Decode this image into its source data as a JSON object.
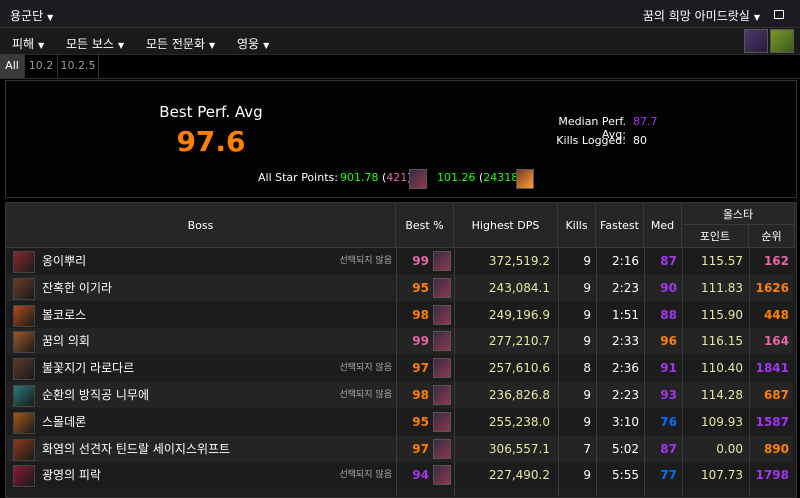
{
  "topbar": {
    "guild": "용군단",
    "raid": "꿈의 희망 아미드랏실"
  },
  "menus": [
    {
      "label": "피해"
    },
    {
      "label": "모든 보스"
    },
    {
      "label": "모든 전문화"
    },
    {
      "label": "영웅"
    }
  ],
  "tabs": [
    {
      "label": "All"
    },
    {
      "label": "10.2"
    },
    {
      "label": "10.2.5"
    }
  ],
  "summary": {
    "best_perf_label": "Best Perf. Avg",
    "best_perf_value": "97.6",
    "median_label": "Median Perf. Avg:",
    "median_value": "87.7",
    "kills_label": "Kills Logged:",
    "kills_value": "80",
    "star_label": "All Star Points:",
    "star1_points": "901.78",
    "star1_rank": "421",
    "star2_points": "101.26",
    "star2_rank": "24318"
  },
  "table": {
    "headers": {
      "boss": "Boss",
      "best": "Best %",
      "dps": "Highest DPS",
      "kills": "Kills",
      "fastest": "Fastest",
      "med": "Med",
      "allstar": "올스타",
      "points": "포인트",
      "rank": "순위"
    },
    "rows": [
      {
        "name": "옹이뿌리",
        "tag": "선택되지 않음",
        "best": "99",
        "dps": "372,519.2",
        "kills": "9",
        "fastest": "2:16",
        "med": "87",
        "points": "115.57",
        "rank": "162",
        "best_color": "#e268a8",
        "med_color": "#a335ee",
        "rank_color": "#e268a8",
        "icon_color": "#8a2a30"
      },
      {
        "name": "잔혹한 이기라",
        "tag": "",
        "best": "95",
        "dps": "243,084.1",
        "kills": "9",
        "fastest": "2:23",
        "med": "90",
        "points": "111.83",
        "rank": "1626",
        "best_color": "#ff8000",
        "med_color": "#a335ee",
        "rank_color": "#ff8000",
        "icon_color": "#6a3a2a"
      },
      {
        "name": "볼코로스",
        "tag": "",
        "best": "98",
        "dps": "249,196.9",
        "kills": "9",
        "fastest": "1:51",
        "med": "88",
        "points": "115.90",
        "rank": "448",
        "best_color": "#ff8000",
        "med_color": "#a335ee",
        "rank_color": "#ff8000",
        "icon_color": "#b04a1a"
      },
      {
        "name": "꿈의 의회",
        "tag": "",
        "best": "99",
        "dps": "277,210.7",
        "kills": "9",
        "fastest": "2:33",
        "med": "96",
        "points": "116.15",
        "rank": "164",
        "best_color": "#e268a8",
        "med_color": "#ff8000",
        "rank_color": "#e268a8",
        "icon_color": "#9a5a2a"
      },
      {
        "name": "불꽃지기 라로다르",
        "tag": "선택되지 않음",
        "best": "97",
        "dps": "257,610.6",
        "kills": "8",
        "fastest": "2:36",
        "med": "91",
        "points": "110.40",
        "rank": "1841",
        "best_color": "#ff8000",
        "med_color": "#a335ee",
        "rank_color": "#a335ee",
        "icon_color": "#5a3a2a"
      },
      {
        "name": "순환의 방직공 니무에",
        "tag": "선택되지 않음",
        "best": "98",
        "dps": "236,826.8",
        "kills": "9",
        "fastest": "2:23",
        "med": "93",
        "points": "114.28",
        "rank": "687",
        "best_color": "#ff8000",
        "med_color": "#a335ee",
        "rank_color": "#ff8000",
        "icon_color": "#2a7a7a"
      },
      {
        "name": "스몰데론",
        "tag": "",
        "best": "95",
        "dps": "255,238.0",
        "kills": "9",
        "fastest": "3:10",
        "med": "76",
        "points": "109.93",
        "rank": "1587",
        "best_color": "#ff8000",
        "med_color": "#0070ff",
        "rank_color": "#a335ee",
        "icon_color": "#a05a1a"
      },
      {
        "name": "화염의 선견자 틴드랄 세이지스위프트",
        "tag": "",
        "best": "97",
        "dps": "306,557.1",
        "kills": "7",
        "fastest": "5:02",
        "med": "87",
        "points": "0.00",
        "rank": "890",
        "best_color": "#ff8000",
        "med_color": "#a335ee",
        "rank_color": "#ff8000",
        "icon_color": "#8a3a1a"
      },
      {
        "name": "광영의 피락",
        "tag": "선택되지 않음",
        "best": "94",
        "dps": "227,490.2",
        "kills": "9",
        "fastest": "5:55",
        "med": "77",
        "points": "107.73",
        "rank": "1798",
        "best_color": "#a335ee",
        "med_color": "#0070ff",
        "rank_color": "#a335ee",
        "icon_color": "#8a1a3a"
      }
    ]
  }
}
